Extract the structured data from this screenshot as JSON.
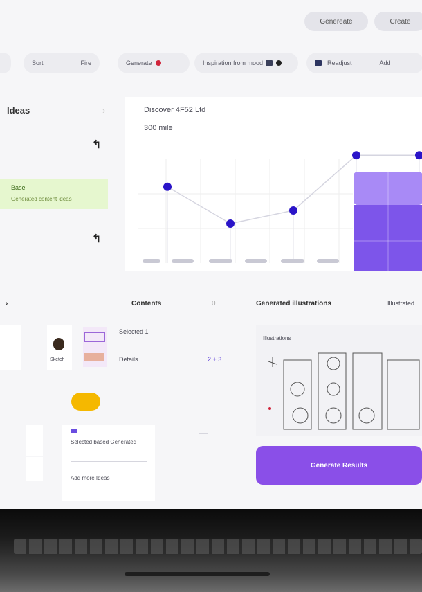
{
  "header": {
    "buttons": [
      "Genereate",
      "Create"
    ]
  },
  "filters": {
    "pill1": {
      "left": "Sort",
      "right": "Fire"
    },
    "pill2": {
      "label": "Generate"
    },
    "pill3": {
      "label": "Inspiration from mood"
    },
    "pill4": {
      "label": "Readjust",
      "extra": "Add"
    }
  },
  "sidebar": {
    "title": "Ideas",
    "highlight": {
      "title": "Base",
      "subtitle": "Generated content ideas"
    }
  },
  "chart_panel": {
    "title": "Discover 4F52 Ltd",
    "value": "300 mile"
  },
  "chart_data": {
    "type": "line",
    "x": [
      1,
      2,
      3,
      4,
      5
    ],
    "values": [
      58,
      30,
      40,
      82,
      82
    ],
    "ylim": [
      0,
      100
    ]
  },
  "lower_left": {
    "title": "Contents",
    "counter": "0",
    "avatar_caption": "Sketch",
    "items": [
      {
        "label": "Selected 1",
        "value": ""
      },
      {
        "label": "Details",
        "value": "2 + 3"
      }
    ],
    "notes": {
      "line1": "Selected based Generated",
      "line2": "Add more Ideas"
    }
  },
  "lower_right": {
    "title": "Generated illustrations",
    "tag": "Illustrated",
    "sketch_label": "Illustrations",
    "cta": "Generate Results"
  },
  "colors": {
    "accent": "#8a4fe8",
    "chart_point": "#2a14c8",
    "highlight": "#e6f7cf",
    "yellow": "#f5b800"
  }
}
